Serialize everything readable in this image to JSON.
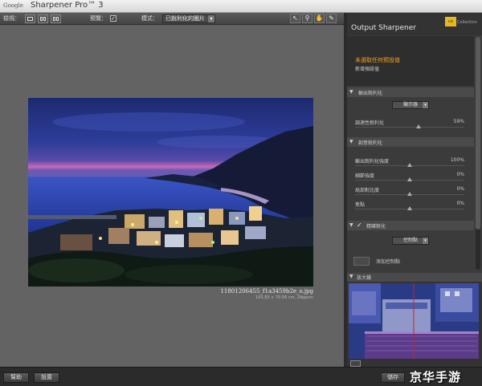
{
  "title_bar": {
    "brand": "Google",
    "app_name": "Sharpener Pro™ 3"
  },
  "toolbar": {
    "view_label": "檢視：",
    "preview_label": "預覽：",
    "preview_checked": "✓",
    "mode_label": "模式：",
    "mode_value": "已銳利化的圖片"
  },
  "image": {
    "filename": "11801206455_f1a3459b2e_o.jpg",
    "dimensions": "105.83 × 70.56 cm, 28ppcm"
  },
  "panel": {
    "title": "Output Sharpener",
    "badge": "nik",
    "collection": "Collection",
    "preset_selected": "未選取任何預設值",
    "preset_add": "新增預設值",
    "sections": {
      "output": "輸出銳利化",
      "creative": "創意銳利化",
      "selective": "精確銳化",
      "loupe": "放大鏡"
    },
    "display_select": "顯示器",
    "adaptive": {
      "label": "調適性銳利化",
      "value": "59%"
    },
    "creative_params": [
      {
        "label": "輸出銳利化強度",
        "value": "100%"
      },
      {
        "label": "細節強度",
        "value": "0%"
      },
      {
        "label": "局部對比度",
        "value": "0%"
      },
      {
        "label": "焦點",
        "value": "0%"
      }
    ],
    "control_select": "控制點",
    "add_control_point": "添加控制點"
  },
  "bottom": {
    "help": "幫助",
    "settings": "設置",
    "apply": "儲存"
  },
  "watermark": "京华手游",
  "colors": {
    "accent_orange": "#f0a020",
    "panel_bg": "#3b3b3b",
    "canvas_bg": "#636363"
  }
}
